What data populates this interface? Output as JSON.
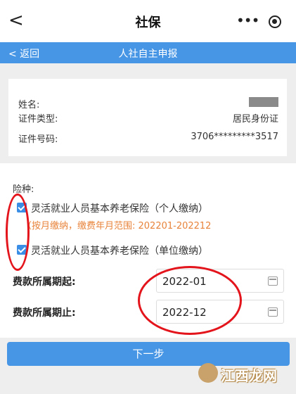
{
  "topbar": {
    "back_icon": "<",
    "title": "社保",
    "more_icon": "•••"
  },
  "navbar": {
    "back_label": "< 返回",
    "title": "人社自主申报"
  },
  "info": {
    "name_label": "姓名:",
    "id_type_label": "证件类型:",
    "id_type_value": "居民身份证",
    "id_no_label": "证件号码:",
    "id_no_value": "3706*********3517"
  },
  "insurance": {
    "section_label": "险种:",
    "option1": "灵活就业人员基本养老保险（个人缴纳）",
    "note": "（按月缴纳，缴费年月范围: 202201-202212",
    "option2": "灵活就业人员基本养老保险（单位缴纳）",
    "start_label": "费款所属期起:",
    "start_value": "2022-01",
    "end_label": "费款所属期止:",
    "end_value": "2022-12"
  },
  "next_button": "下一步",
  "watermark": "江西龙网",
  "colors": {
    "primary": "#4796e6",
    "note": "#e8833a",
    "annotation": "#e3141b"
  }
}
